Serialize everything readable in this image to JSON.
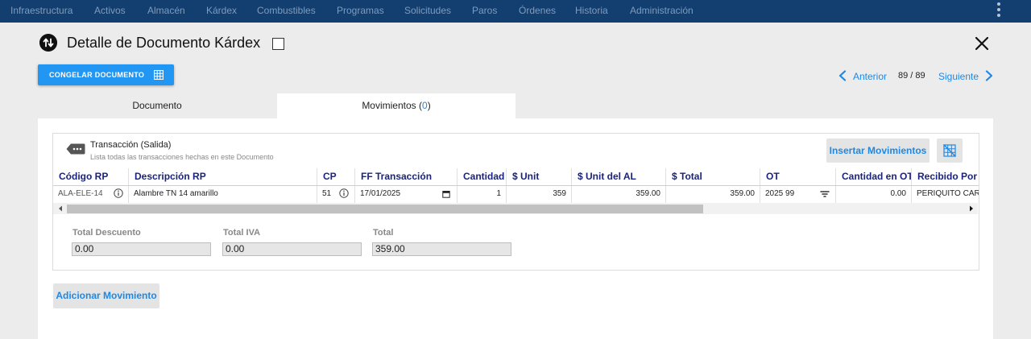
{
  "nav": {
    "items": [
      "Infraestructura",
      "Activos",
      "Almacén",
      "Kárdex",
      "Combustibles",
      "Programas",
      "Solicitudes",
      "Paros",
      "Órdenes",
      "Historia",
      "Administración"
    ]
  },
  "header": {
    "title": "Detalle de Documento Kárdex",
    "freeze_label": "CONGELAR DOCUMENTO"
  },
  "pager": {
    "prev_label": "Anterior",
    "count": "89 / 89",
    "next_label": "Siguiente"
  },
  "tabs": {
    "documento": "Documento",
    "movimientos": "Movimientos (",
    "movimientos_count": "0",
    "movimientos_close": ")"
  },
  "transaction": {
    "title": "Transacción (Salida)",
    "subtitle": "Lista todas las transacciones hechas en este Documento",
    "insert_label": "Insertar Movimientos"
  },
  "table": {
    "columns": [
      "Código RP",
      "Descripción RP",
      "CP",
      "FF Transacción",
      "Cantidad",
      "$ Unit",
      "$ Unit del AL",
      "$ Total",
      "OT",
      "Cantidad en OT",
      "Recibido Por"
    ],
    "rows": [
      {
        "codigo": "ALA-ELE-14",
        "descripcion": "Alambre TN 14 amarillo",
        "cp": "51",
        "fecha": "17/01/2025",
        "cantidad": "1",
        "unit": "359",
        "unit_al": "359.00",
        "total": "359.00",
        "ot": "2025 99",
        "cantidad_ot": "0.00",
        "recibido": "PERIQUITO CARD"
      }
    ]
  },
  "totals": {
    "descuento_label": "Total Descuento",
    "descuento_value": "0.00",
    "iva_label": "Total IVA",
    "iva_value": "0.00",
    "total_label": "Total",
    "total_value": "359.00"
  },
  "actions": {
    "add_label": "Adicionar Movimiento"
  },
  "colors": {
    "nav_bg": "#123f70",
    "accent": "#2196f3",
    "header_text": "#1a237e"
  }
}
